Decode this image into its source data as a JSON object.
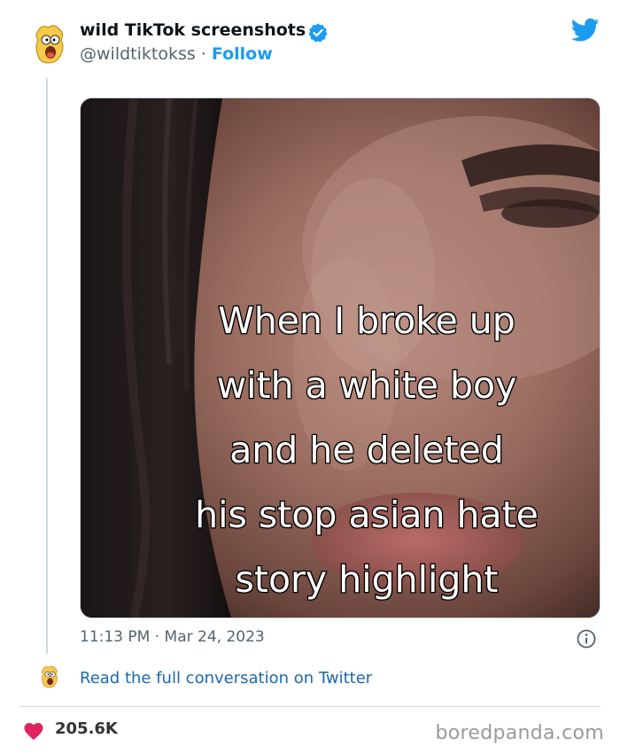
{
  "tweet": {
    "display_name": "wild TikTok screenshots",
    "handle": "@wildtiktokss",
    "separator": " · ",
    "follow_label": "Follow",
    "media_caption": "When I broke up\nwith a white boy\nand he deleted\nhis stop asian hate\nstory highlight",
    "timestamp": "11:13 PM · Mar 24, 2023",
    "read_more_label": "Read the full conversation on Twitter"
  },
  "footer": {
    "like_count": "205.6K",
    "watermark": "boredpanda.com"
  },
  "icons": {
    "verified": "verified-badge-icon",
    "brand": "twitter-bird-icon",
    "info": "info-icon",
    "heart": "heart-icon"
  },
  "colors": {
    "accent": "#1d9bf0",
    "link": "#1d68ad",
    "heart": "#e0245e",
    "muted": "#536471"
  }
}
